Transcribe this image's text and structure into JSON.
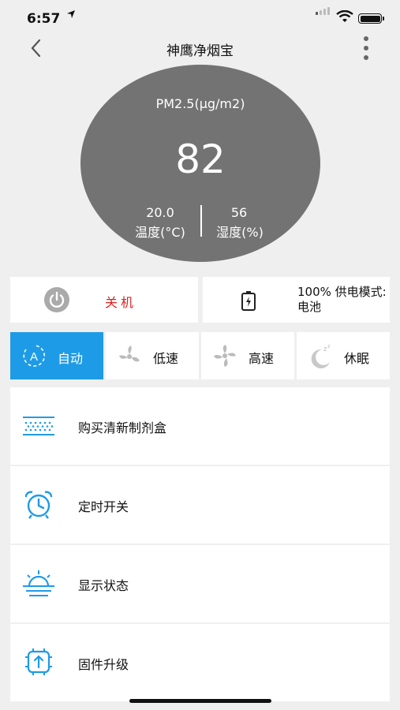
{
  "status_bar": {
    "time": "6:57",
    "location_arrow": "location-arrow-icon"
  },
  "nav": {
    "title": "神鹰净烟宝",
    "back_icon": "chevron-left-icon",
    "more_icon": "more-vertical-icon"
  },
  "gauge": {
    "label": "PM2.5(μg/m2)",
    "value": "82",
    "temperature_value": "20.0",
    "temperature_label": "温度(°C)",
    "humidity_value": "56",
    "humidity_label": "湿度(%)"
  },
  "power": {
    "label": "关机",
    "color": "#e02020"
  },
  "battery": {
    "label": "100% 供电模式:电池"
  },
  "modes": [
    {
      "label": "自动",
      "icon": "auto-mode-icon",
      "active": true
    },
    {
      "label": "低速",
      "icon": "fan-low-icon",
      "active": false
    },
    {
      "label": "高速",
      "icon": "fan-high-icon",
      "active": false
    },
    {
      "label": "休眠",
      "icon": "sleep-moon-icon",
      "active": false
    }
  ],
  "menu": [
    {
      "label": "购买清新制剂盒",
      "icon": "filter-box-icon"
    },
    {
      "label": "定时开关",
      "icon": "alarm-clock-icon"
    },
    {
      "label": "显示状态",
      "icon": "sunrise-icon"
    },
    {
      "label": "固件升级",
      "icon": "firmware-chip-icon"
    }
  ],
  "colors": {
    "accent": "#1e9be6",
    "gauge": "#737373",
    "background": "#efefef"
  }
}
